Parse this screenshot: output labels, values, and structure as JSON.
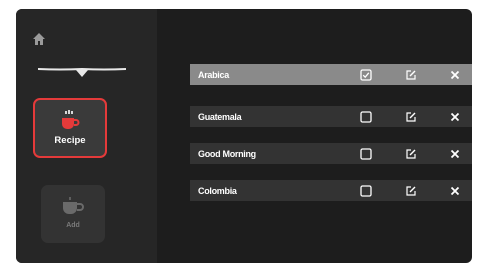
{
  "sidebar": {
    "nav": [
      {
        "label": "Recipe",
        "active": true,
        "icon": "coffee-cup-icon"
      },
      {
        "label": "Add",
        "active": false,
        "icon": "coffee-cup-add-icon"
      }
    ],
    "home_icon": "home-icon",
    "accent_color": "#e43a3a"
  },
  "recipes": [
    {
      "name": "Arabica",
      "checked": true,
      "selected": true
    },
    {
      "name": "Guatemala",
      "checked": false,
      "selected": false
    },
    {
      "name": "Good Morning",
      "checked": false,
      "selected": false
    },
    {
      "name": "Colombia",
      "checked": false,
      "selected": false
    }
  ],
  "row_actions": [
    "checkbox-icon",
    "edit-icon",
    "close-icon"
  ]
}
